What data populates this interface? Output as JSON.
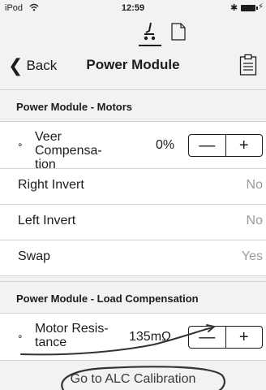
{
  "status_bar": {
    "carrier": "iPod",
    "time": "12:59"
  },
  "nav": {
    "back_label": "Back",
    "title": "Power Module"
  },
  "sections": [
    {
      "header": "Power Module - Motors",
      "rows": [
        {
          "label": "Veer Compensation",
          "label_line1": "Veer Compensa-",
          "label_line2": "tion",
          "value": "0%",
          "decrement": "—",
          "increment": "+"
        },
        {
          "label": "Right Invert",
          "value": "No"
        },
        {
          "label": "Left Invert",
          "value": "No"
        },
        {
          "label": "Swap",
          "value": "Yes"
        }
      ]
    },
    {
      "header": "Power Module - Load Compensation",
      "rows": [
        {
          "label": "Motor Resistance",
          "label_line1": "Motor Resis-",
          "label_line2": "tance",
          "value": "135mΩ",
          "decrement": "—",
          "increment": "+"
        }
      ]
    }
  ],
  "footer": {
    "alc_link": "Go to ALC Calibration"
  },
  "colors": {
    "background": "#f2f2f2",
    "row_background": "#ffffff",
    "muted_value": "#9a9a9a",
    "annotation_stroke": "#333333"
  },
  "icons": {
    "wifi": "wifi-icon",
    "bluetooth": "bluetooth-icon",
    "battery": "battery-icon",
    "chair_tab": "wheelchair-settings-icon",
    "document_tab": "document-icon",
    "clipboard": "clipboard-icon",
    "back": "chevron-left-icon"
  }
}
